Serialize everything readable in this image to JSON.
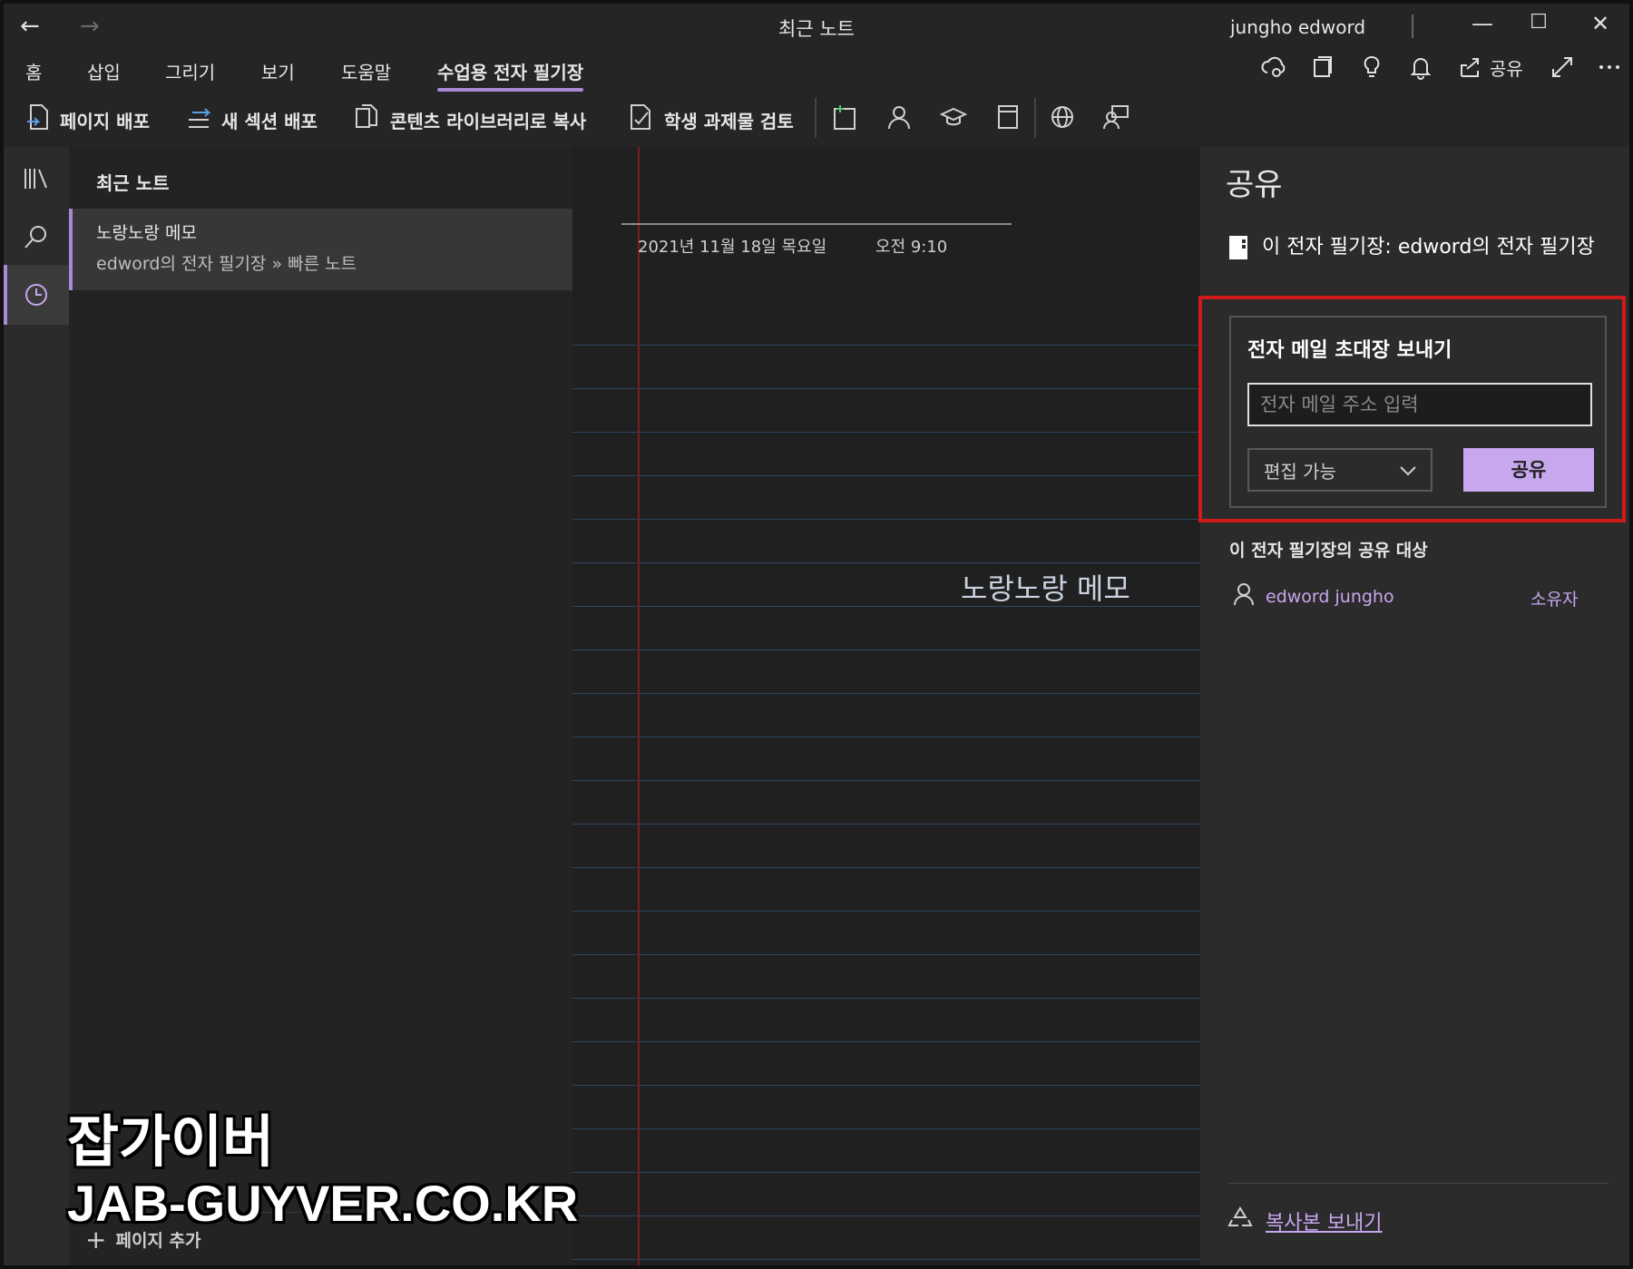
{
  "window": {
    "title": "최근 노트",
    "user": "jungho edword",
    "back_glyph": "←",
    "forward_glyph": "→",
    "minimize_glyph": "—",
    "maximize_glyph": "☐",
    "close_glyph": "✕"
  },
  "ribbon": {
    "tabs": [
      {
        "label": "홈"
      },
      {
        "label": "삽입"
      },
      {
        "label": "그리기"
      },
      {
        "label": "보기"
      },
      {
        "label": "도움말"
      },
      {
        "label": "수업용 전자 필기장",
        "active": true
      }
    ],
    "share_label": "공유",
    "right_icons": [
      "sync-icon",
      "pages-icon",
      "lightbulb-icon",
      "bell-icon",
      "share-icon",
      "expand-icon",
      "more-icon"
    ]
  },
  "toolbar": {
    "buttons": [
      {
        "label": "페이지 배포",
        "icon": "distribute-page-icon"
      },
      {
        "label": "새 섹션 배포",
        "icon": "distribute-section-icon"
      },
      {
        "label": "콘텐츠 라이브러리로 복사",
        "icon": "copy-library-icon"
      },
      {
        "label": "학생 과제물 검토",
        "icon": "review-icon"
      }
    ],
    "icons": [
      "add-page-icon",
      "person-icon",
      "graduation-icon",
      "notebook-icon",
      "globe-icon",
      "teams-icon"
    ]
  },
  "rail": {
    "icons": [
      "notebooks-icon",
      "search-icon",
      "recent-icon"
    ]
  },
  "pagelist": {
    "header": "최근 노트",
    "items": [
      {
        "title": "노랑노랑 메모",
        "path": "edword의 전자 필기장 » 빠른 노트"
      }
    ],
    "add_page": "페이지 추가",
    "add_glyph": "+"
  },
  "note": {
    "date": "2021년 11월 18일 목요일",
    "time": "오전 9:10",
    "body": "노랑노랑 메모"
  },
  "share_panel": {
    "title": "공유",
    "notebook_label": "이 전자 필기장: edword의 전자 필기장",
    "invite_label": "전자 메일 초대장 보내기",
    "email_placeholder": "전자 메일 주소 입력",
    "permission": "편집 가능",
    "share_button": "공유",
    "shared_with_header": "이 전자 필기장의 공유 대상",
    "members": [
      {
        "name": "edword jungho",
        "role": "소유자"
      }
    ],
    "send_copy": "복사본 보내기"
  },
  "watermark": {
    "line1": "잡가이버",
    "line2": "JAB-GUYVER.CO.KR"
  },
  "colors": {
    "accent": "#a889d6",
    "share_button_bg": "#c7a7ee",
    "highlight_border": "#d11a1a",
    "margin_line": "#7a1c22",
    "rule_line": "#2c4560"
  }
}
